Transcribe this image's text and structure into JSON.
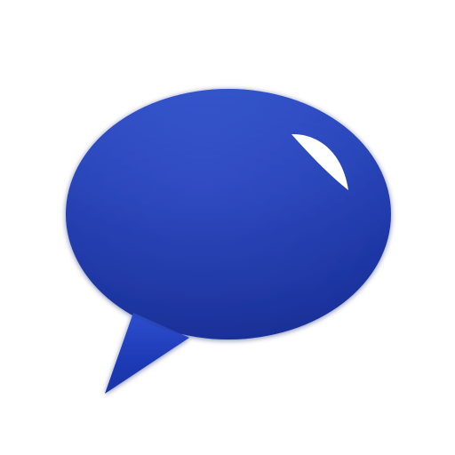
{
  "icon": {
    "name": "speech-bubble-icon",
    "colors": {
      "fill_top": "#2d4fd0",
      "fill_mid": "#1f3bb7",
      "fill_bottom": "#1a33a6",
      "outline_shadow": "#0e1f6b",
      "highlight": "#ffffff",
      "background": "#ffffff"
    }
  }
}
